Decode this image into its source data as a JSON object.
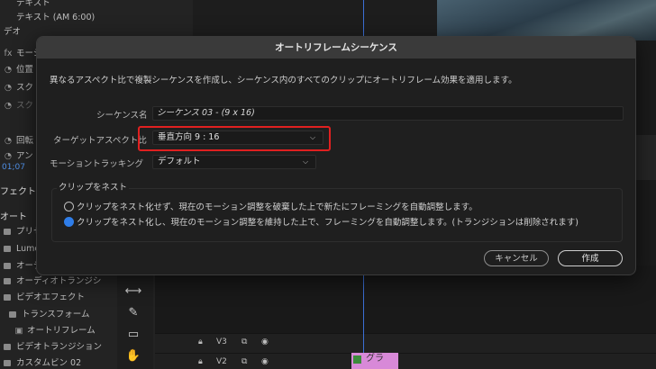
{
  "background": {
    "left_panel_rows": [
      {
        "icon": "",
        "text": "テキスト"
      },
      {
        "icon": "",
        "text": "テキスト (AM 6:00)"
      },
      {
        "icon": "",
        "text": "デオ"
      },
      {
        "icon": "fx",
        "text": "モーシ"
      },
      {
        "icon": "◔",
        "text": "位置"
      },
      {
        "icon": "◔",
        "text": "スク"
      },
      {
        "icon": "◔",
        "text": "スク"
      },
      {
        "icon": "◔",
        "text": "回転"
      },
      {
        "icon": "◔",
        "text": "アン"
      }
    ],
    "timecode": "01;07",
    "effects_label": "フェクト",
    "effects_select": "オート",
    "effects_tree": [
      {
        "text": "プリセ"
      },
      {
        "text": "Lumet"
      },
      {
        "text": "オーデ"
      },
      {
        "text": "オーディオトランジシ"
      },
      {
        "text": "ビデオエフェクト"
      },
      {
        "text": "トランスフォーム"
      },
      {
        "text": "オートリフレーム"
      },
      {
        "text": "ビデオトランジション"
      },
      {
        "text": "カスタムビン 02"
      }
    ],
    "tracks": [
      {
        "name": "V3"
      },
      {
        "name": "V2"
      }
    ],
    "clip_label": "グラ"
  },
  "dialog": {
    "title": "オートリフレームシーケンス",
    "description": "異なるアスペクト比で複製シーケンスを作成し、シーケンス内のすべてのクリップにオートリフレーム効果を適用します。",
    "sequence_name_label": "シーケンス名",
    "sequence_name_value": "シーケンス 03 - (9 x 16)",
    "target_aspect_label": "ターゲットアスペクト比",
    "target_aspect_value": "垂直方向 9 : 16",
    "motion_tracking_label": "モーショントラッキング",
    "motion_tracking_value": "デフォルト",
    "nest_group_title": "クリップをネスト",
    "nest_options": [
      {
        "label": "クリップをネスト化せず、現在のモーション調整を破棄した上で新たにフレーミングを自動調整します。",
        "checked": false
      },
      {
        "label": "クリップをネスト化し、現在のモーション調整を維持した上で、フレーミングを自動調整します。(トランジションは削除されます)",
        "checked": true
      }
    ],
    "cancel_label": "キャンセル",
    "create_label": "作成"
  },
  "colors": {
    "accent": "#2f7de8",
    "highlight": "#e02020"
  }
}
